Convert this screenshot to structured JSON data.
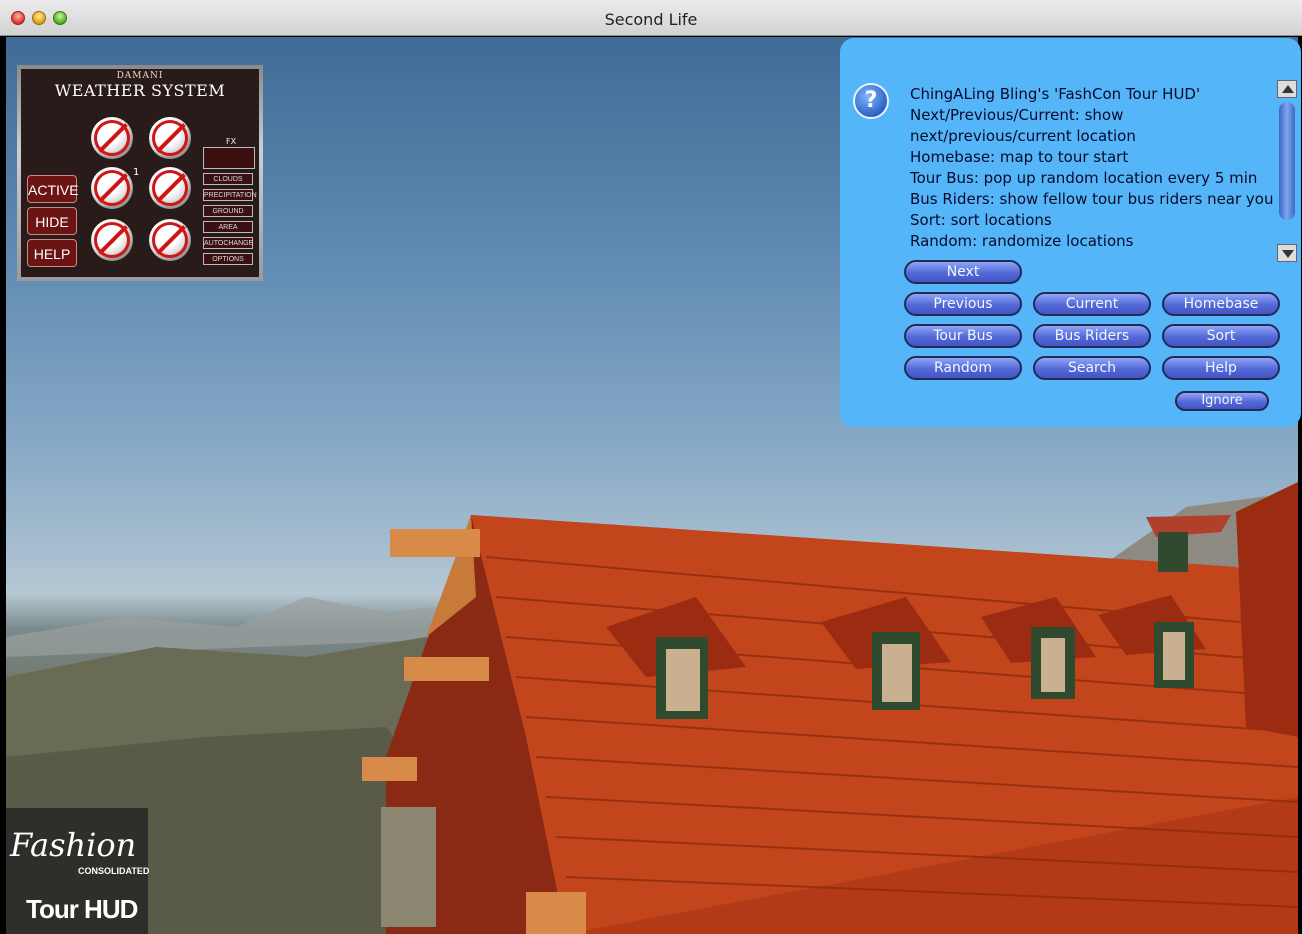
{
  "window": {
    "title": "Second Life"
  },
  "weather_hud": {
    "brand": "DAMANI",
    "title": "WEATHER SYSTEM",
    "buttons": [
      "ACTIVE",
      "HIDE",
      "HELP"
    ],
    "fx_label": "FX",
    "fx_buttons": [
      "CLOUDS",
      "PRECIPITATION",
      "GROUND",
      "AREA",
      "AUTOCHANGE",
      "OPTIONS"
    ],
    "badge": "1"
  },
  "dialog": {
    "lines": [
      "ChingALing Bling's 'FashCon Tour HUD'",
      "Next/Previous/Current: show",
      "next/previous/current location",
      "Homebase: map to tour start",
      "Tour Bus: pop up random location every 5 min",
      "Bus Riders: show fellow tour bus riders near you",
      "Sort: sort locations",
      "Random: randomize locations"
    ],
    "buttons": {
      "next": "Next",
      "previous": "Previous",
      "current": "Current",
      "homebase": "Homebase",
      "tour_bus": "Tour Bus",
      "bus_riders": "Bus Riders",
      "sort": "Sort",
      "random": "Random",
      "search": "Search",
      "help": "Help",
      "ignore": "Ignore"
    },
    "icon": "question-icon"
  },
  "fashion_hud": {
    "script": "Fashion",
    "subtitle": "CONSOLIDATED",
    "label": "Tour HUD"
  }
}
